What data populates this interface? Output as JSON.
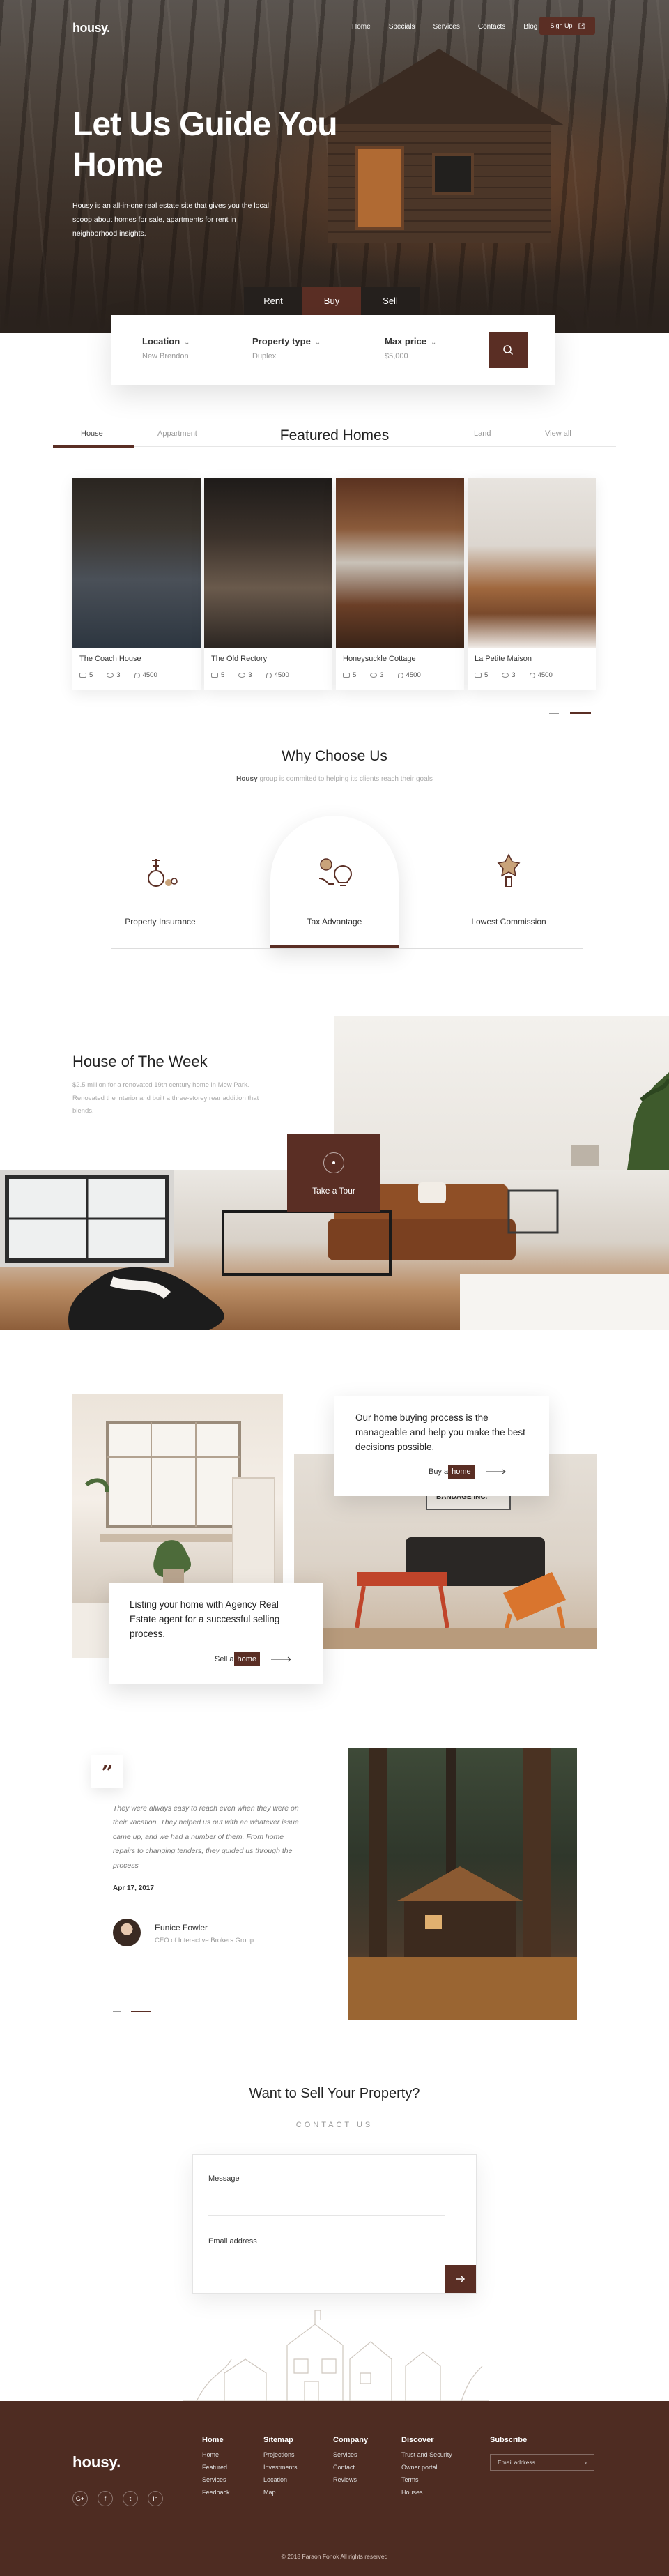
{
  "brand": "housy.",
  "nav": {
    "links": [
      "Home",
      "Specials",
      "Services",
      "Contacts",
      "Blog"
    ],
    "signup": "Sign Up"
  },
  "hero": {
    "title": "Let Us Guide You Home",
    "subtitle": "Housy is an all-in-one real estate site that gives you the local scoop about homes for sale, apartments for rent in neighborhood insights.",
    "tabs": [
      "Rent",
      "Buy",
      "Sell"
    ]
  },
  "search": {
    "location_label": "Location",
    "location_value": "New Brendon",
    "type_label": "Property type",
    "type_value": "Duplex",
    "price_label": "Max price",
    "price_value": "$5,000"
  },
  "featured": {
    "title": "Featured Homes",
    "tabs": [
      "House",
      "Appartment",
      "Land",
      "View all"
    ],
    "cards": [
      {
        "name": "The Coach House",
        "beds": "5",
        "baths": "3",
        "area": "4500"
      },
      {
        "name": "The Old Rectory",
        "beds": "5",
        "baths": "3",
        "area": "4500"
      },
      {
        "name": "Honeysuckle Cottage",
        "beds": "5",
        "baths": "3",
        "area": "4500"
      },
      {
        "name": "La Petite Maison",
        "beds": "5",
        "baths": "3",
        "area": "4500"
      }
    ]
  },
  "why": {
    "title": "Why Choose Us",
    "sub_brand": "Housy",
    "sub_rest": "group is commited to helping its clients reach their goals",
    "items": [
      "Property Insurance",
      "Tax Advantage",
      "Lowest Commission"
    ]
  },
  "how": {
    "title": "House of The Week",
    "desc": "$2.5 million for a renovated 19th century home in Mew Park. Renovated the interior and built a three-storey rear addition that blends.",
    "tour": "Take a Tour"
  },
  "buying": {
    "card1_text": "Our home buying process is the manageable and help you make the best decisions possible.",
    "card1_link_a": "Buy a",
    "card1_link_b": "home",
    "card2_text": "Listing your home with Agency Real Estate agent for a successful selling process.",
    "card2_link_a": "Sell a",
    "card2_link_b": "home",
    "sign_text": "BANDAGE INC."
  },
  "testimonial": {
    "mark": "”",
    "text": "They were always easy to reach even when they were on their vacation. They helped us out with an whatever issue came up, and we had a number of them. From home repairs to changing tenders, they guided us through the process",
    "date": "Apr 17, 2017",
    "author": "Eunice Fowler",
    "role": "CEO of Interactive Brokers Group"
  },
  "contact": {
    "title": "Want to Sell Your Property?",
    "sub": "CONTACT US",
    "message_label": "Message",
    "email_label": "Email address"
  },
  "footer": {
    "logo": "housy.",
    "social": [
      "G+",
      "f",
      "t",
      "in"
    ],
    "cols": [
      {
        "h": "Home",
        "items": [
          "Home",
          "Featured",
          "Services",
          "Feedback"
        ]
      },
      {
        "h": "Sitemap",
        "items": [
          "Projections",
          "Investments",
          "Location",
          "Map"
        ]
      },
      {
        "h": "Company",
        "items": [
          "Services",
          "Contact",
          "Reviews"
        ]
      },
      {
        "h": "Discover",
        "items": [
          "Trust and Security",
          "Owner portal",
          "Terms",
          "Houses"
        ]
      }
    ],
    "subscribe": "Subscribe",
    "email_placeholder": "Email address",
    "copyright": "© 2018 Faraon Fonok All rights reserved"
  },
  "colors": {
    "accent": "#5a2e24",
    "footer": "#4e2c22"
  }
}
